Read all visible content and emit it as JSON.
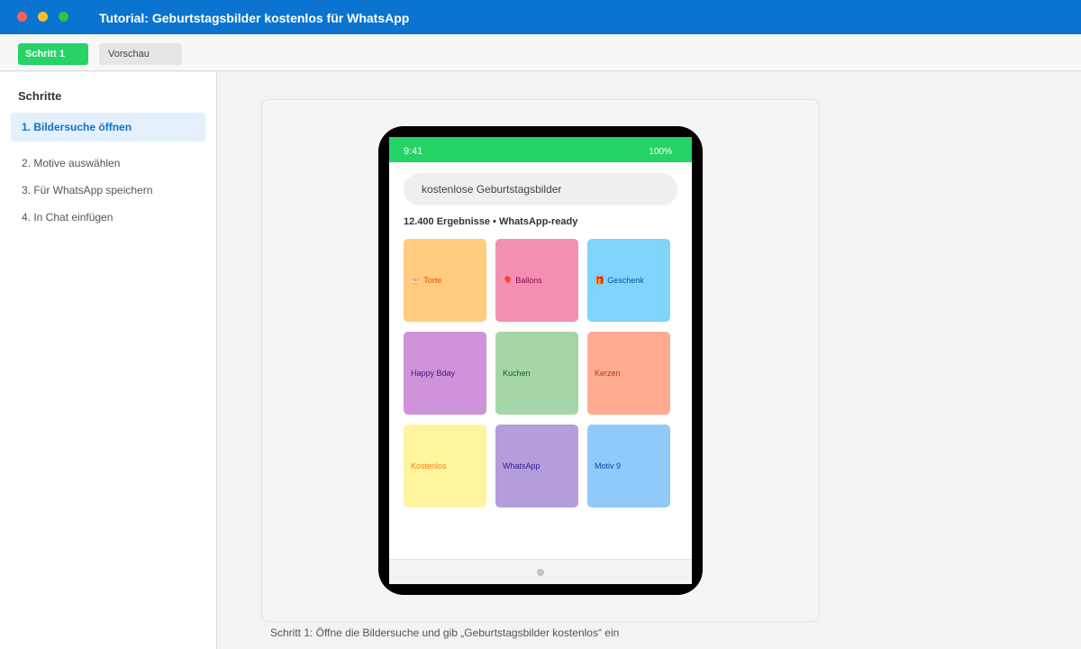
{
  "window": {
    "title": "Tutorial: Geburtstagsbilder kostenlos für WhatsApp"
  },
  "toolbar": {
    "step_label": "Schritt 1",
    "preview_label": "Vorschau"
  },
  "sidebar": {
    "title": "Schritte",
    "items": [
      {
        "label": "1. Bildersuche öffnen",
        "active": true
      },
      {
        "label": "2. Motive auswählen",
        "active": false
      },
      {
        "label": "3. Für WhatsApp speichern",
        "active": false
      },
      {
        "label": "4. In Chat einfügen",
        "active": false
      }
    ]
  },
  "phone": {
    "status_time": "9:41",
    "status_battery": "100%",
    "search_value": "kostenlose Geburtstagsbilder",
    "results_text": "12.400 Ergebnisse • WhatsApp-ready",
    "tiles": [
      {
        "emoji": "🎂",
        "label": "Torte",
        "bg": "#ffcc80",
        "fg": "#e65100",
        "icon": "cake-icon"
      },
      {
        "emoji": "🎈",
        "label": "Ballons",
        "bg": "#f48fb1",
        "fg": "#880e4f",
        "icon": "balloon-icon"
      },
      {
        "emoji": "🎁",
        "label": "Geschenk",
        "bg": "#81d4fa",
        "fg": "#01579b",
        "icon": "gift-icon"
      },
      {
        "emoji": "",
        "label": "Happy Bday",
        "bg": "#ce93d8",
        "fg": "#4a148c",
        "icon": ""
      },
      {
        "emoji": "",
        "label": "Kuchen",
        "bg": "#a5d6a7",
        "fg": "#1b5e20",
        "icon": ""
      },
      {
        "emoji": "",
        "label": "Kerzen",
        "bg": "#ffab91",
        "fg": "#bf360c",
        "icon": ""
      },
      {
        "emoji": "",
        "label": "Kostenlos",
        "bg": "#fff59d",
        "fg": "#f57f17",
        "icon": ""
      },
      {
        "emoji": "",
        "label": "WhatsApp",
        "bg": "#b39ddb",
        "fg": "#311b92",
        "icon": ""
      },
      {
        "emoji": "",
        "label": "Motiv 9",
        "bg": "#90caf9",
        "fg": "#0d47a1",
        "icon": ""
      }
    ]
  },
  "caption": "Schritt 1: Öffne die Bildersuche und gib „Geburtstagsbilder kostenlos“ ein",
  "colors": {
    "title_bar": "#0a74d0",
    "accent_green": "#25d366",
    "active_item_bg": "#e4f0fc",
    "active_item_text": "#0a74d0"
  }
}
